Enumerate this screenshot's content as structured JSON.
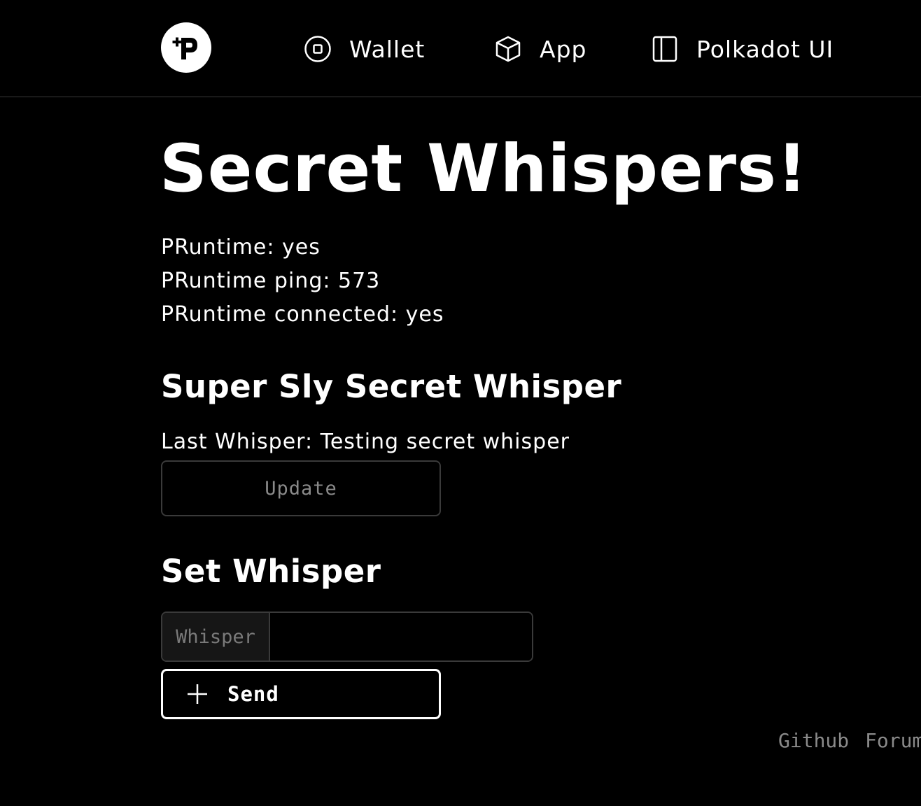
{
  "nav": {
    "logo_icon": "phala-logo-icon",
    "items": [
      {
        "label": "Wallet",
        "icon": "wallet-icon"
      },
      {
        "label": "App",
        "icon": "cube-icon"
      },
      {
        "label": "Polkadot UI",
        "icon": "sidebar-panel-icon"
      }
    ]
  },
  "page": {
    "title": "Secret Whispers!"
  },
  "status": {
    "line1": "PRuntime: yes",
    "line2": "PRuntime ping: 573",
    "line3": "PRuntime connected: yes"
  },
  "sly_section": {
    "heading": "Super Sly Secret Whisper",
    "last_whisper": "Last Whisper: Testing secret whisper",
    "update_label": "Update"
  },
  "set_section": {
    "heading": "Set Whisper",
    "input_label": "Whisper",
    "input_value": "",
    "send_label": "Send",
    "send_icon": "plus-icon"
  },
  "footer": {
    "links": [
      "Github",
      "Forum"
    ]
  },
  "colors": {
    "background": "#000000",
    "text": "#ffffff",
    "muted": "#8a8a8a",
    "border": "#3a3a3a"
  }
}
